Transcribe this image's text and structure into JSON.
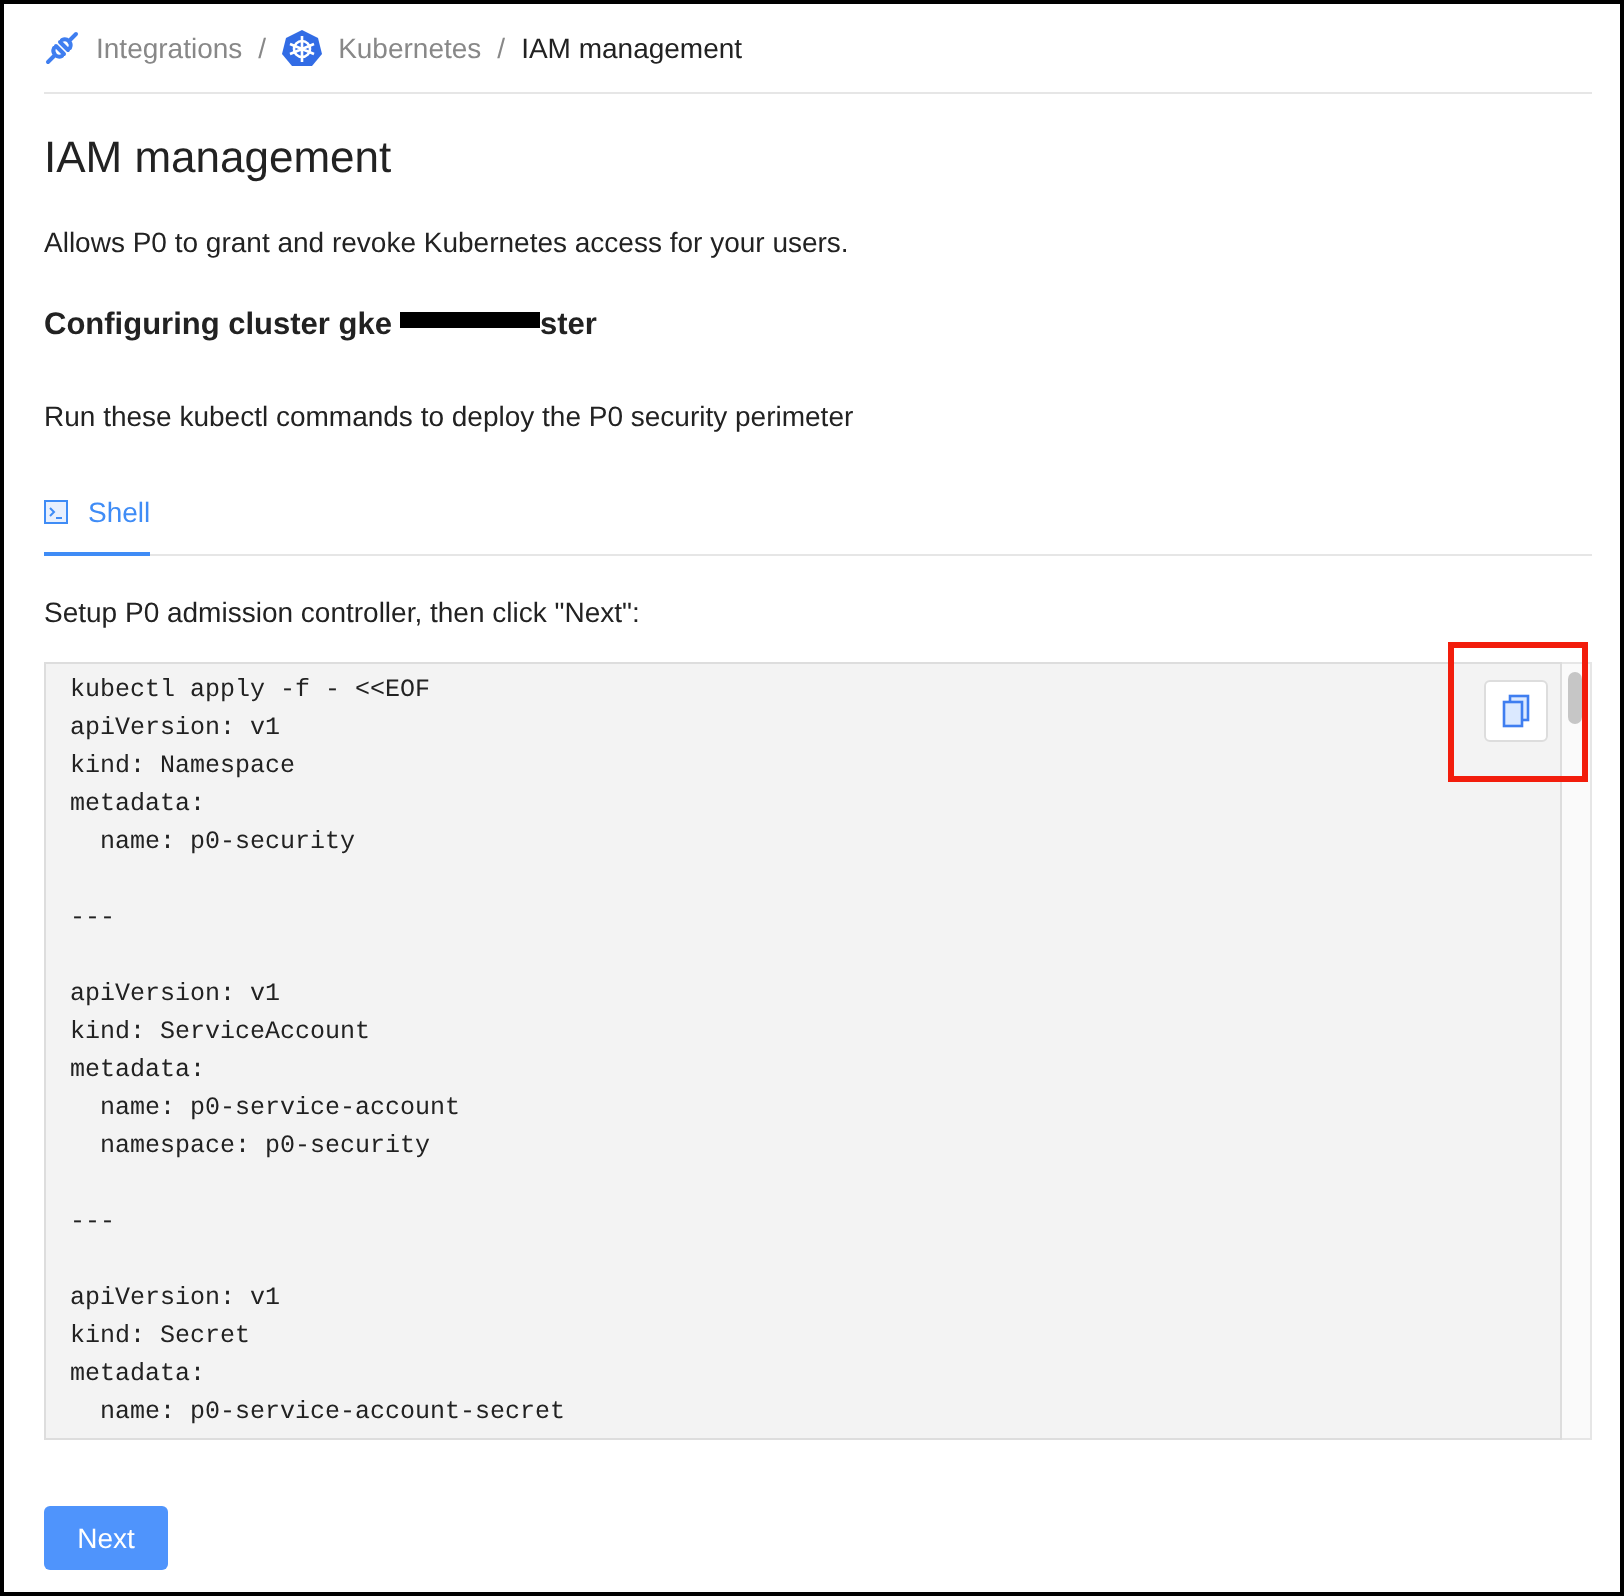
{
  "breadcrumb": [
    {
      "kind": "integrations",
      "label": "Integrations"
    },
    {
      "kind": "kubernetes",
      "label": "Kubernetes"
    },
    {
      "kind": "current",
      "label": "IAM management"
    }
  ],
  "breadcrumb_separators": [
    "/",
    "/"
  ],
  "title": "IAM management",
  "description": "Allows P0 to grant and revoke Kubernetes access for your users.",
  "cluster_heading": {
    "prefix": "Configuring cluster gke",
    "suffix": "ster",
    "redacted": true
  },
  "instructions": "Run these kubectl commands to deploy the P0 security perimeter",
  "tabs": [
    {
      "label": "Shell",
      "selected": true
    }
  ],
  "step_text": "Setup P0 admission controller, then click \"Next\":",
  "code": "kubectl apply -f - <<EOF\napiVersion: v1\nkind: Namespace\nmetadata:\n  name: p0-security\n\n---\n\napiVersion: v1\nkind: ServiceAccount\nmetadata:\n  name: p0-service-account\n  namespace: p0-security\n\n---\n\napiVersion: v1\nkind: Secret\nmetadata:\n  name: p0-service-account-secret",
  "copy_highlighted": true,
  "next_button": "Next"
}
